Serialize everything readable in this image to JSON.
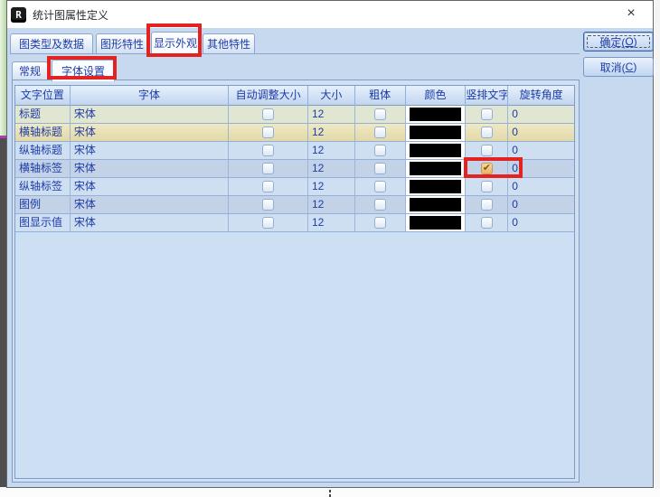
{
  "window": {
    "title": "统计图属性定义",
    "icon_glyph": "R",
    "close_glyph": "×"
  },
  "tabs": [
    {
      "label": "图类型及数据",
      "active": false
    },
    {
      "label": "图形特性",
      "active": false
    },
    {
      "label": "显示外观",
      "active": true,
      "annotated": true
    },
    {
      "label": "其他特性",
      "active": false
    }
  ],
  "subtabs": [
    {
      "label": "常规",
      "active": false
    },
    {
      "label": "字体设置",
      "active": true,
      "annotated": true
    }
  ],
  "buttons": {
    "ok": {
      "pre": "确定(",
      "key": "O",
      "post": ")"
    },
    "cancel": {
      "pre": "取消(",
      "key": "C",
      "post": ")"
    }
  },
  "table": {
    "columns": [
      "文字位置",
      "字体",
      "自动调整大小",
      "大小",
      "粗体",
      "颜色",
      "竖排文字",
      "旋转角度"
    ],
    "rows": [
      {
        "position": "标题",
        "font": "宋体",
        "auto_size": false,
        "size": "12",
        "bold": false,
        "color": "#000000",
        "vertical": false,
        "rotation": "0",
        "tone": "cream"
      },
      {
        "position": "横轴标题",
        "font": "宋体",
        "auto_size": false,
        "size": "12",
        "bold": false,
        "color": "#000000",
        "vertical": false,
        "rotation": "0",
        "tone": "khaki"
      },
      {
        "position": "纵轴标题",
        "font": "宋体",
        "auto_size": false,
        "size": "12",
        "bold": false,
        "color": "#000000",
        "vertical": false,
        "rotation": "0",
        "tone": "light"
      },
      {
        "position": "横轴标签",
        "font": "宋体",
        "auto_size": false,
        "size": "12",
        "bold": false,
        "color": "#000000",
        "vertical": true,
        "rotation": "0",
        "tone": "dark",
        "annotated": true
      },
      {
        "position": "纵轴标签",
        "font": "宋体",
        "auto_size": false,
        "size": "12",
        "bold": false,
        "color": "#000000",
        "vertical": false,
        "rotation": "0",
        "tone": "light"
      },
      {
        "position": "图例",
        "font": "宋体",
        "auto_size": false,
        "size": "12",
        "bold": false,
        "color": "#000000",
        "vertical": false,
        "rotation": "0",
        "tone": "dark"
      },
      {
        "position": "图显示值",
        "font": "宋体",
        "auto_size": false,
        "size": "12",
        "bold": false,
        "color": "#000000",
        "vertical": false,
        "rotation": "0",
        "tone": "light"
      }
    ]
  },
  "glyphs": {
    "check": "✔"
  },
  "colors": {
    "annotation_red": "#e32222",
    "dialog_bg": "#c7d9ef",
    "text_blue": "#1e3ca8",
    "row_cream": "#e0e6d2",
    "row_khaki": "#e8e1b4",
    "row_light": "#cfdff2",
    "row_dark": "#c3d2e6",
    "swatch_black": "#000000",
    "checked_checkbox": "#eec27c"
  }
}
